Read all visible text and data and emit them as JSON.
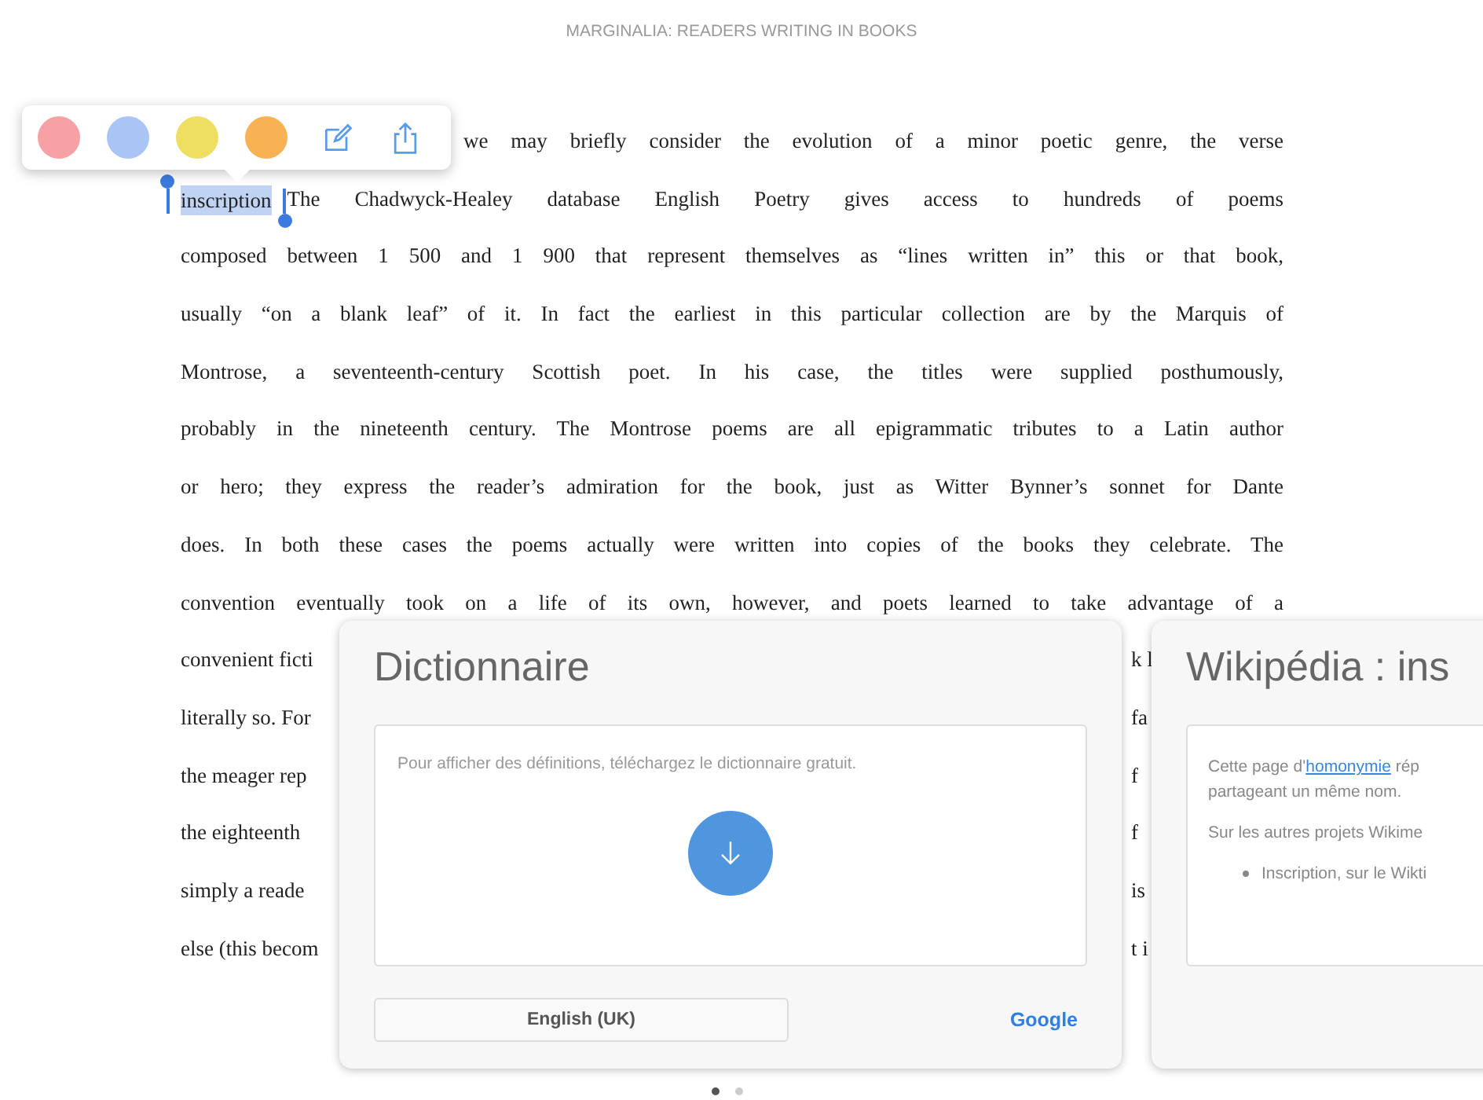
{
  "header": {
    "title": "MARGINALIA: READERS WRITING IN BOOKS"
  },
  "toolbar": {
    "swatches": [
      {
        "color": "#f7a1a4"
      },
      {
        "color": "#a9c5f6"
      },
      {
        "color": "#eede62"
      },
      {
        "color": "#f8b153"
      }
    ]
  },
  "lines": [
    {
      "kind": "indented",
      "text": "we may briefly consider the evolution of a minor poetic genre, the verse"
    },
    {
      "kind": "selected",
      "selection": "inscription",
      "text": "The Chadwyck-Healey database English Poetry gives access to hundreds of poems"
    },
    {
      "kind": "full",
      "text": "composed between 1 500 and 1 900 that represent themselves as “lines written in” this or that book,"
    },
    {
      "kind": "full",
      "text": "usually “on a blank leaf” of it. In fact the earliest in this particular collection are by the Marquis of"
    },
    {
      "kind": "full",
      "text": "Montrose, a seventeenth-century Scottish poet. In his case, the titles were supplied posthumously,"
    },
    {
      "kind": "full",
      "text": "probably in the nineteenth century. The Montrose poems are all epigrammatic tributes to a Latin author"
    },
    {
      "kind": "full",
      "text": "or hero; they express the reader’s admiration for the book, just as Witter Bynner’s sonnet for Dante"
    },
    {
      "kind": "full",
      "text": "does. In both these cases the poems actually were written into copies of the books they celebrate. The"
    },
    {
      "kind": "full",
      "text": "convention eventually took on a life of its own, however, and poets learned to take advantage of a"
    },
    {
      "kind": "split",
      "left": "convenient ficti",
      "right": "k l"
    },
    {
      "kind": "split",
      "left": "literally so. For",
      "right": "fa"
    },
    {
      "kind": "split",
      "left": "the meager rep",
      "right": "f"
    },
    {
      "kind": "split",
      "left": "the eighteenth",
      "right": "f"
    },
    {
      "kind": "split",
      "left": "simply a reade",
      "right": "is"
    },
    {
      "kind": "split",
      "left": "else (this becom",
      "right": "t i"
    }
  ],
  "dictionary": {
    "title": "Dictionnaire",
    "message": "Pour afficher des définitions, téléchargez le dictionnaire gratuit.",
    "language_button": "English (UK)",
    "link": "Google"
  },
  "wikipedia": {
    "title": "Wikipédia : ins",
    "intro_before": "Cette page d'",
    "intro_link": "homonymie",
    "intro_after": " rép",
    "intro_line2": "partageant un même nom.",
    "other_projects": "Sur les autres projets Wikime",
    "bullet": "Inscription, sur le Wikti"
  },
  "page_dots": [
    {
      "selected": true
    },
    {
      "selected": false
    }
  ]
}
